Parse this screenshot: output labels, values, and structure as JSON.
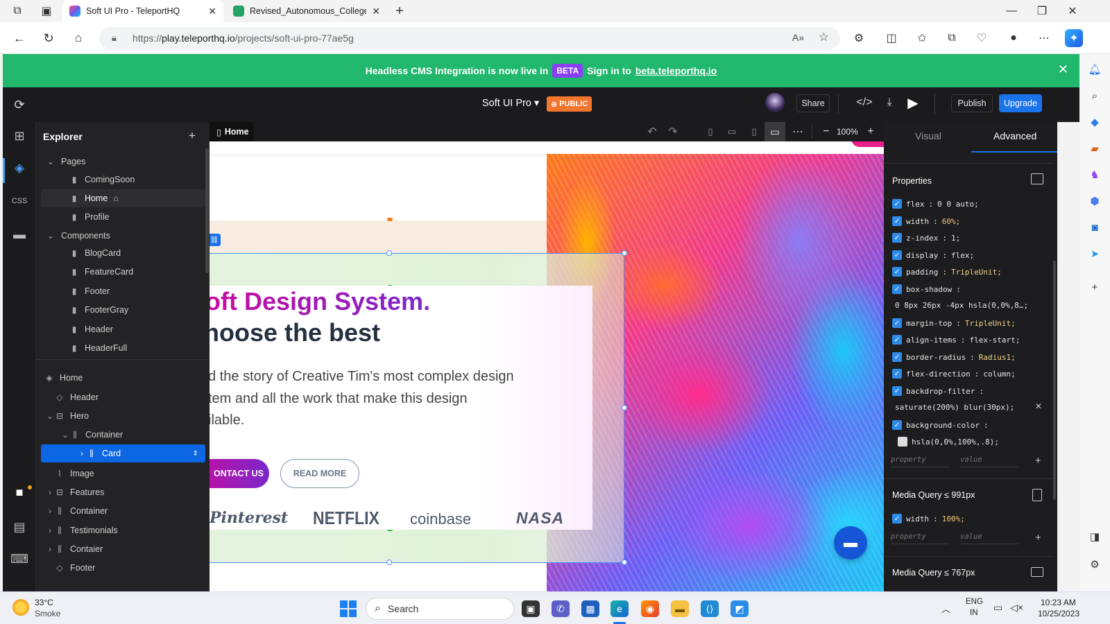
{
  "browser": {
    "tabs": [
      {
        "label": "Soft UI Pro - TeleportHQ",
        "active": true
      },
      {
        "label": "Revised_Autonomous_College_D",
        "active": false
      }
    ],
    "url_prefix": "https://",
    "url_host": "play.teleporthq.io",
    "url_path": "/projects/soft-ui-pro-77ae5g",
    "new_tab": "+"
  },
  "banner": {
    "text": "Headless CMS Integration is now live in",
    "badge": "BETA",
    "signin": "Sign in to",
    "link": "beta.teleporthq.io"
  },
  "topbar": {
    "project_name": "Soft UI Pro ▾",
    "visibility": "PUBLIC",
    "share": "Share",
    "publish": "Publish",
    "upgrade": "Upgrade"
  },
  "explorer": {
    "title": "Explorer",
    "pages_label": "Pages",
    "pages": [
      "ComingSoon",
      "Home",
      "Profile"
    ],
    "components_label": "Components",
    "components": [
      "BlogCard",
      "FeatureCard",
      "Footer",
      "FooterGray",
      "Header",
      "HeaderFull"
    ],
    "tree": {
      "root": "Home",
      "header": "Header",
      "hero": "Hero",
      "container": "Container",
      "card": "Card",
      "image": "Image",
      "features": "Features",
      "container2": "Container",
      "testimonials": "Testimonials",
      "contaier": "Contaier",
      "footer": "Footer"
    }
  },
  "canvas": {
    "tab": "Home",
    "zoom": "100%",
    "hero_title": "oft Design System.",
    "hero_subtitle": "hoose the best",
    "hero_body_1": "d the story of Creative Tim's most complex design",
    "hero_body_2": "tem and all the work that make this design",
    "hero_body_3": "ilable.",
    "contact_btn": "ONTACT US",
    "readmore_btn": "READ MORE",
    "logos": [
      "Pinterest",
      "NETFLIX",
      "coinbase",
      "NASA"
    ]
  },
  "panel": {
    "tab_visual": "Visual",
    "tab_advanced": "Advanced",
    "properties_title": "Properties",
    "props": [
      {
        "k": "flex",
        "v": "0 0 auto;"
      },
      {
        "k": "width",
        "v": "60%;"
      },
      {
        "k": "z-index",
        "v": "1;"
      },
      {
        "k": "display",
        "v": "flex;"
      },
      {
        "k": "padding",
        "v": "TripleUnit;"
      },
      {
        "k": "box-shadow",
        "v": ""
      },
      {
        "k": "margin-top",
        "v": "TripleUnit;"
      },
      {
        "k": "align-items",
        "v": "flex-start;"
      },
      {
        "k": "border-radius",
        "v": "Radius1;"
      },
      {
        "k": "flex-direction",
        "v": "column;"
      },
      {
        "k": "backdrop-filter",
        "v": ""
      },
      {
        "k": "background-color",
        "v": ""
      }
    ],
    "box_shadow_value": "0 8px 26px -4px hsla(0,0%,8…;",
    "backdrop_value": "saturate(200%) blur(30px);",
    "bg_value": "hsla(0,0%,100%,.8);",
    "property_placeholder": "property",
    "value_placeholder": "value",
    "media_991": "Media Query ≤ 991px",
    "media_991_prop": {
      "k": "width",
      "v": "100%;"
    },
    "media_767": "Media Query ≤ 767px"
  },
  "taskbar": {
    "temp": "33°C",
    "weather": "Smoke",
    "search": "Search",
    "lang1": "ENG",
    "lang2": "IN",
    "time": "10:23 AM",
    "date": "10/25/2023"
  },
  "colors": {
    "banner": "#21b76d",
    "accent": "#0d66e4",
    "beta": "#8a3ff5",
    "public": "#f2762e"
  }
}
